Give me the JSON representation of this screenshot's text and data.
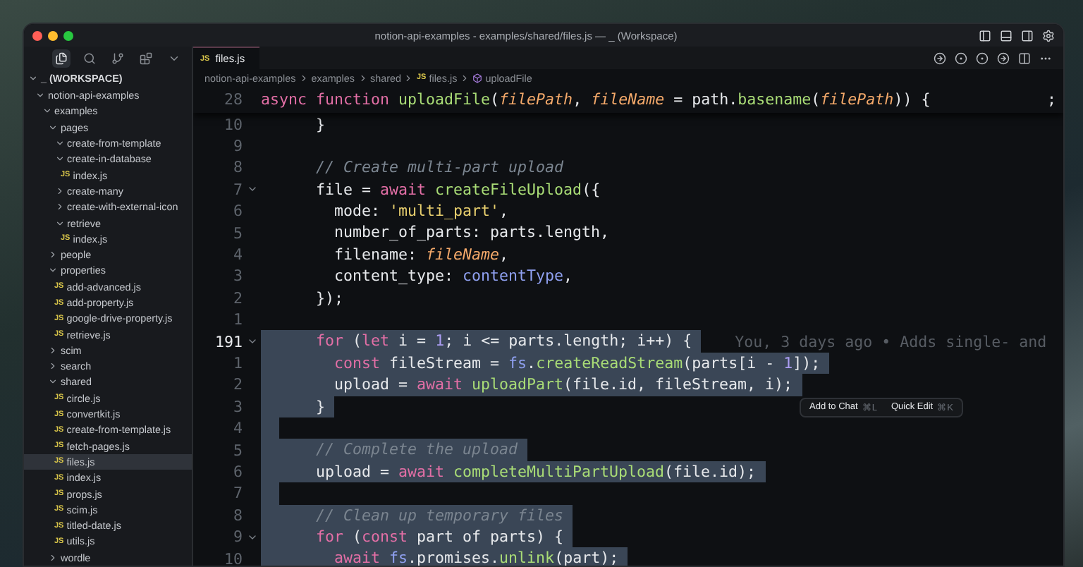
{
  "window": {
    "title": "notion-api-examples - examples/shared/files.js — _ (Workspace)"
  },
  "sidebar": {
    "workspace": {
      "label": "_ (WORKSPACE)",
      "expanded": true
    },
    "tree": [
      {
        "label": "notion-api-examples",
        "kind": "folder",
        "expanded": true,
        "selected": false,
        "children": [
          {
            "label": "examples",
            "kind": "folder",
            "expanded": true,
            "selected": false,
            "children": [
              {
                "label": "pages",
                "kind": "folder",
                "expanded": true,
                "selected": false,
                "children": [
                  {
                    "label": "create-from-template",
                    "kind": "folder",
                    "expanded": true,
                    "selected": false
                  },
                  {
                    "label": "create-in-database",
                    "kind": "folder",
                    "expanded": true,
                    "selected": false,
                    "children": [
                      {
                        "label": "index.js",
                        "kind": "file",
                        "badge": "JS",
                        "selected": false
                      }
                    ]
                  },
                  {
                    "label": "create-many",
                    "kind": "folder",
                    "expanded": false,
                    "selected": false
                  },
                  {
                    "label": "create-with-external-icon",
                    "kind": "folder",
                    "expanded": false,
                    "selected": false
                  },
                  {
                    "label": "retrieve",
                    "kind": "folder",
                    "expanded": true,
                    "selected": false,
                    "children": [
                      {
                        "label": "index.js",
                        "kind": "file",
                        "badge": "JS",
                        "selected": false
                      }
                    ]
                  }
                ]
              },
              {
                "label": "people",
                "kind": "folder",
                "expanded": false,
                "selected": false
              },
              {
                "label": "properties",
                "kind": "folder",
                "expanded": true,
                "selected": false,
                "children": [
                  {
                    "label": "add-advanced.js",
                    "kind": "file",
                    "badge": "JS",
                    "selected": false
                  },
                  {
                    "label": "add-property.js",
                    "kind": "file",
                    "badge": "JS",
                    "selected": false
                  },
                  {
                    "label": "google-drive-property.js",
                    "kind": "file",
                    "badge": "JS",
                    "selected": false
                  },
                  {
                    "label": "retrieve.js",
                    "kind": "file",
                    "badge": "JS",
                    "selected": false
                  }
                ]
              },
              {
                "label": "scim",
                "kind": "folder",
                "expanded": false,
                "selected": false
              },
              {
                "label": "search",
                "kind": "folder",
                "expanded": false,
                "selected": false
              },
              {
                "label": "shared",
                "kind": "folder",
                "expanded": true,
                "selected": false,
                "children": [
                  {
                    "label": "circle.js",
                    "kind": "file",
                    "badge": "JS",
                    "selected": false
                  },
                  {
                    "label": "convertkit.js",
                    "kind": "file",
                    "badge": "JS",
                    "selected": false
                  },
                  {
                    "label": "create-from-template.js",
                    "kind": "file",
                    "badge": "JS",
                    "selected": false
                  },
                  {
                    "label": "fetch-pages.js",
                    "kind": "file",
                    "badge": "JS",
                    "selected": false
                  },
                  {
                    "label": "files.js",
                    "kind": "file",
                    "badge": "JS",
                    "selected": true
                  },
                  {
                    "label": "index.js",
                    "kind": "file",
                    "badge": "JS",
                    "selected": false
                  },
                  {
                    "label": "props.js",
                    "kind": "file",
                    "badge": "JS",
                    "selected": false
                  },
                  {
                    "label": "scim.js",
                    "kind": "file",
                    "badge": "JS",
                    "selected": false
                  },
                  {
                    "label": "titled-date.js",
                    "kind": "file",
                    "badge": "JS",
                    "selected": false
                  },
                  {
                    "label": "utils.js",
                    "kind": "file",
                    "badge": "JS",
                    "selected": false
                  }
                ]
              },
              {
                "label": "wordle",
                "kind": "folder",
                "expanded": false,
                "selected": false
              }
            ]
          }
        ]
      }
    ]
  },
  "tabs": [
    {
      "label": "files.js",
      "badge": "JS",
      "selected": true
    }
  ],
  "breadcrumb": [
    {
      "label": "notion-api-examples",
      "kind": "folder"
    },
    {
      "label": "examples",
      "kind": "folder"
    },
    {
      "label": "shared",
      "kind": "folder"
    },
    {
      "label": "files.js",
      "kind": "file",
      "badge": "JS"
    },
    {
      "label": "uploadFile",
      "kind": "symbol"
    }
  ],
  "sticky": {
    "number": "28",
    "trailing": ";",
    "tokens": [
      {
        "text": "async function ",
        "kind": "kw"
      },
      {
        "text": "uploadFile",
        "kind": "fn"
      },
      {
        "text": "(",
        "kind": "punc"
      },
      {
        "text": "filePath",
        "kind": "param"
      },
      {
        "text": ", ",
        "kind": "punc"
      },
      {
        "text": "fileName",
        "kind": "param"
      },
      {
        "text": " = ",
        "kind": "punc"
      },
      {
        "text": "path",
        "kind": "plain"
      },
      {
        "text": ".",
        "kind": "punc"
      },
      {
        "text": "basename",
        "kind": "fn"
      },
      {
        "text": "(",
        "kind": "punc"
      },
      {
        "text": "filePath",
        "kind": "param"
      },
      {
        "text": ")) {",
        "kind": "punc"
      }
    ]
  },
  "lines": [
    {
      "number": "10",
      "current": false,
      "selected": false,
      "fold": false,
      "tokens": [
        {
          "text": "      }",
          "kind": "punc"
        }
      ]
    },
    {
      "number": "9",
      "current": false,
      "selected": false,
      "fold": false
    },
    {
      "number": "8",
      "current": false,
      "selected": false,
      "fold": false,
      "tokens": [
        {
          "text": "      // Create multi-part upload",
          "kind": "com"
        }
      ]
    },
    {
      "number": "7",
      "current": false,
      "selected": false,
      "fold": true,
      "tokens": [
        {
          "text": "      file",
          "kind": "plain"
        },
        {
          "text": " = ",
          "kind": "punc"
        },
        {
          "text": "await ",
          "kind": "kw"
        },
        {
          "text": "createFileUpload",
          "kind": "fn"
        },
        {
          "text": "({",
          "kind": "punc"
        }
      ]
    },
    {
      "number": "6",
      "current": false,
      "selected": false,
      "fold": false,
      "tokens": [
        {
          "text": "        mode: ",
          "kind": "plain"
        },
        {
          "text": "'multi_part'",
          "kind": "str"
        },
        {
          "text": ",",
          "kind": "punc"
        }
      ]
    },
    {
      "number": "5",
      "current": false,
      "selected": false,
      "fold": false,
      "tokens": [
        {
          "text": "        number_of_parts: ",
          "kind": "plain"
        },
        {
          "text": "parts",
          "kind": "plain"
        },
        {
          "text": ".length,",
          "kind": "punc"
        }
      ]
    },
    {
      "number": "4",
      "current": false,
      "selected": false,
      "fold": false,
      "tokens": [
        {
          "text": "        filename: ",
          "kind": "plain"
        },
        {
          "text": "fileName",
          "kind": "param"
        },
        {
          "text": ",",
          "kind": "punc"
        }
      ]
    },
    {
      "number": "3",
      "current": false,
      "selected": false,
      "fold": false,
      "tokens": [
        {
          "text": "        content_type: ",
          "kind": "plain"
        },
        {
          "text": "contentType",
          "kind": "var"
        },
        {
          "text": ",",
          "kind": "punc"
        }
      ]
    },
    {
      "number": "2",
      "current": false,
      "selected": false,
      "fold": false,
      "tokens": [
        {
          "text": "      });",
          "kind": "punc"
        }
      ]
    },
    {
      "number": "1",
      "current": false,
      "selected": false,
      "fold": false
    },
    {
      "number": "191",
      "current": true,
      "selected": true,
      "fold": true,
      "blame": "You, 3 days ago • Adds single- and",
      "tokens": [
        {
          "text": "      for ",
          "kind": "kw"
        },
        {
          "text": "(",
          "kind": "punc"
        },
        {
          "text": "let ",
          "kind": "kw"
        },
        {
          "text": "i = ",
          "kind": "plain"
        },
        {
          "text": "1",
          "kind": "num"
        },
        {
          "text": "; i <= parts.length; i++) {",
          "kind": "plain"
        }
      ]
    },
    {
      "number": "1",
      "current": false,
      "selected": true,
      "fold": false,
      "tokens": [
        {
          "text": "        const ",
          "kind": "kw"
        },
        {
          "text": "fileStream = ",
          "kind": "plain"
        },
        {
          "text": "fs",
          "kind": "var"
        },
        {
          "text": ".",
          "kind": "punc"
        },
        {
          "text": "createReadStream",
          "kind": "fn"
        },
        {
          "text": "(parts[i - ",
          "kind": "plain"
        },
        {
          "text": "1",
          "kind": "num"
        },
        {
          "text": "]);",
          "kind": "punc"
        }
      ]
    },
    {
      "number": "2",
      "current": false,
      "selected": true,
      "fold": false,
      "tokens": [
        {
          "text": "        upload = ",
          "kind": "plain"
        },
        {
          "text": "await ",
          "kind": "kw"
        },
        {
          "text": "uploadPart",
          "kind": "fn"
        },
        {
          "text": "(file.id, fileStream, i);",
          "kind": "plain"
        }
      ]
    },
    {
      "number": "3",
      "current": false,
      "selected": true,
      "fold": false,
      "tokens": [
        {
          "text": "      }",
          "kind": "punc"
        }
      ]
    },
    {
      "number": "4",
      "current": false,
      "selected": true,
      "fold": false
    },
    {
      "number": "5",
      "current": false,
      "selected": true,
      "fold": false,
      "tokens": [
        {
          "text": "      // Complete the upload",
          "kind": "com"
        }
      ]
    },
    {
      "number": "6",
      "current": false,
      "selected": true,
      "fold": false,
      "tokens": [
        {
          "text": "      upload = ",
          "kind": "plain"
        },
        {
          "text": "await ",
          "kind": "kw"
        },
        {
          "text": "completeMultiPartUpload",
          "kind": "fn"
        },
        {
          "text": "(file.id);",
          "kind": "plain"
        }
      ]
    },
    {
      "number": "7",
      "current": false,
      "selected": true,
      "fold": false
    },
    {
      "number": "8",
      "current": false,
      "selected": true,
      "fold": false,
      "tokens": [
        {
          "text": "      // Clean up temporary files",
          "kind": "com"
        }
      ]
    },
    {
      "number": "9",
      "current": false,
      "selected": true,
      "fold": true,
      "tokens": [
        {
          "text": "      for ",
          "kind": "kw"
        },
        {
          "text": "(",
          "kind": "punc"
        },
        {
          "text": "const ",
          "kind": "kw"
        },
        {
          "text": "part of parts) {",
          "kind": "plain"
        }
      ]
    },
    {
      "number": "10",
      "current": false,
      "selected": true,
      "fold": false,
      "tokens": [
        {
          "text": "        await ",
          "kind": "kw"
        },
        {
          "text": "fs",
          "kind": "var"
        },
        {
          "text": ".promises.",
          "kind": "plain"
        },
        {
          "text": "unlink",
          "kind": "fn"
        },
        {
          "text": "(part);",
          "kind": "plain"
        }
      ]
    }
  ],
  "selection_menu": [
    {
      "label": "Add to Chat",
      "shortcut": "⌘L"
    },
    {
      "label": "Quick Edit",
      "shortcut": "⌘K"
    }
  ]
}
